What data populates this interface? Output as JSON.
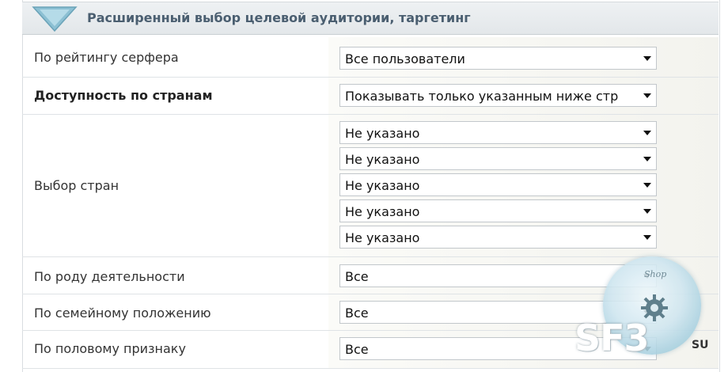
{
  "section": {
    "title": "Расширенный выбор целевой аудитории, таргетинг"
  },
  "rows": {
    "surfer_rating": {
      "label": "По рейтингу серфера",
      "value": "Все пользователи"
    },
    "country_availability": {
      "label": "Доступность по странам",
      "value": "Показывать только указанным ниже стр"
    },
    "country_selection": {
      "label": "Выбор стран",
      "values": [
        "Не указано",
        "Не указано",
        "Не указано",
        "Не указано",
        "Не указано"
      ]
    },
    "occupation": {
      "label": "По роду деятельности",
      "value": "Все"
    },
    "marital_status": {
      "label": "По семейному положению",
      "value": "Все"
    },
    "gender": {
      "label": "По половому признаку",
      "value": "Все"
    }
  },
  "watermark": {
    "top_text": "Shop",
    "logo_text": "SF3",
    "suffix": "SU"
  },
  "colors": {
    "header_text": "#4a5e70",
    "header_arrow": "#7fb3c8",
    "watermark_badge": "#9ecbdc"
  },
  "icons": {
    "header": "triangle-down-icon",
    "dropdown": "dropdown-arrow-icon",
    "watermark": "gear-icon"
  }
}
